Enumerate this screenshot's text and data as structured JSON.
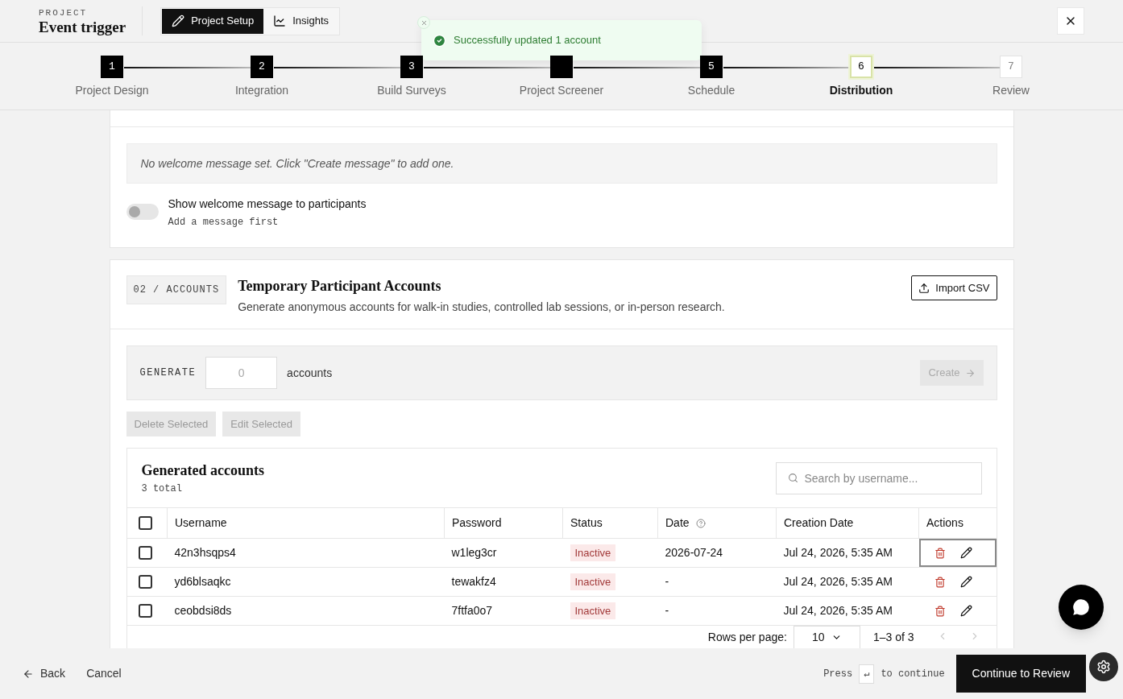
{
  "header": {
    "eyebrow": "PROJECT",
    "title": "Event trigger",
    "tabs": [
      {
        "label": "Project Setup",
        "selected": true
      },
      {
        "label": "Insights",
        "selected": false
      }
    ]
  },
  "toast": {
    "message": "Successfully updated 1 account"
  },
  "stepper": [
    {
      "number": "1",
      "label": "Project Design",
      "completed": true,
      "selected": false
    },
    {
      "number": "2",
      "label": "Integration",
      "completed": true,
      "selected": false
    },
    {
      "number": "3",
      "label": "Build Surveys",
      "completed": true,
      "selected": false
    },
    {
      "label": "Project Screener",
      "completed": true,
      "selected": false
    },
    {
      "number": "5",
      "label": "Schedule",
      "completed": true,
      "selected": false
    },
    {
      "number": "6",
      "label": "Distribution",
      "completed": false,
      "selected": true
    },
    {
      "number": "7",
      "label": "Review",
      "completed": false,
      "selected": false
    }
  ],
  "welcome": {
    "empty_message": "No welcome message set. Click \"Create message\" to add one.",
    "toggle": {
      "label": "Show welcome message to participants",
      "hint": "Add a message first",
      "on": false
    }
  },
  "accounts_section": {
    "tag": "02 / ACCOUNTS",
    "title": "Temporary Participant Accounts",
    "description": "Generate anonymous accounts for walk-in studies, controlled lab sessions, or in-person research.",
    "import_button": "Import CSV",
    "generate": {
      "label": "GENERATE",
      "placeholder": "0",
      "unit": "accounts",
      "create_button": "Create",
      "create_disabled": true
    },
    "bulk_actions": [
      {
        "label": "Delete Selected",
        "disabled": true
      },
      {
        "label": "Edit Selected",
        "disabled": true
      }
    ],
    "table": {
      "title": "Generated accounts",
      "select_all_checked": false,
      "count": "3 total",
      "search_placeholder": "Search by username...",
      "columns": [
        "Username",
        "Password",
        "Status",
        "Date",
        "Creation Date",
        "Actions"
      ],
      "rows": [
        {
          "checked": false,
          "focused": true,
          "username": "42n3hsqps4",
          "password": "w1leg3cr",
          "status": "Inactive",
          "date": "2026-07-24",
          "created": "Jul 24, 2026, 5:35 AM"
        },
        {
          "checked": false,
          "focused": false,
          "username": "yd6blsaqkc",
          "password": "tewakfz4",
          "status": "Inactive",
          "date": "-",
          "created": "Jul 24, 2026, 5:35 AM"
        },
        {
          "checked": false,
          "focused": false,
          "username": "ceobdsi8ds",
          "password": "7ftfa0o7",
          "status": "Inactive",
          "date": "-",
          "created": "Jul 24, 2026, 5:35 AM"
        }
      ],
      "rows_per_page_label": "Rows per page:",
      "rows_per_page": "10",
      "range": "1–3 of 3"
    }
  },
  "footer": {
    "back": "Back",
    "cancel": "Cancel",
    "hint_before": "Press",
    "hint_key": "↵",
    "hint_after": "to continue",
    "continue_button": "Continue to Review"
  }
}
